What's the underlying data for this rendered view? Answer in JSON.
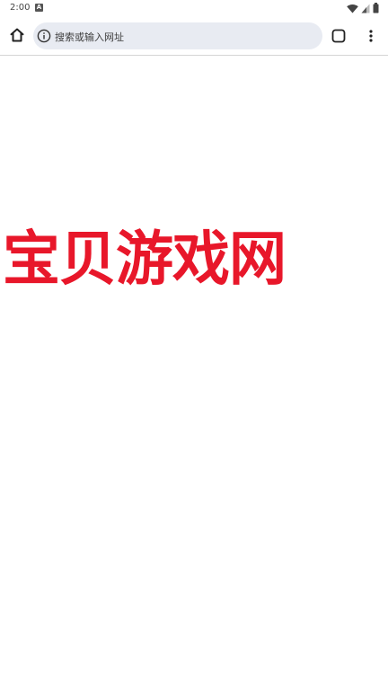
{
  "status_bar": {
    "time": "2:00",
    "notification_badge": "A",
    "icons": [
      "wifi-icon",
      "cell-signal-icon",
      "battery-icon"
    ]
  },
  "toolbar": {
    "address_placeholder": "搜索或输入网址",
    "icons": [
      "home-icon",
      "info-icon",
      "tab-switcher-icon",
      "more-vert-icon"
    ]
  },
  "page": {
    "logo_text": "宝贝游戏网",
    "logo_color": "#e8172a"
  },
  "colors": {
    "omnibox_bg": "#e8ebf2",
    "page_bg": "#ffffff"
  }
}
